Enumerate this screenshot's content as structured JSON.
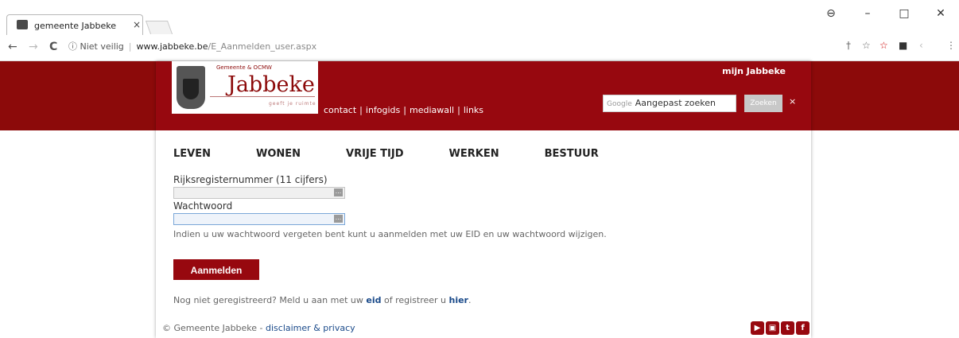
{
  "browser": {
    "tab_title": "gemeente Jabbeke",
    "tab_close": "×",
    "window_buttons": [
      "⊖",
      "–",
      "□",
      "✕"
    ],
    "nav": {
      "back": "←",
      "forward": "→",
      "reload": "C"
    },
    "security": "ⓘ Niet veilig",
    "host": "www.jabbeke.be",
    "path": "/E_Aanmelden_user.aspx"
  },
  "header": {
    "logo_top": "Gemeente & OCMW",
    "logo_name": "Jabbeke",
    "logo_tag": "geeft je ruimte",
    "links": [
      "contact",
      "infogids",
      "mediawall",
      "links"
    ],
    "mijn": "mijn Jabbeke",
    "search_brand": "Google",
    "search_placeholder": "Aangepast zoeken",
    "search_button": "Zoeken",
    "search_close": "×"
  },
  "menu": [
    "LEVEN",
    "WONEN",
    "VRIJE TIJD",
    "WERKEN",
    "BESTUUR"
  ],
  "form": {
    "rrn_label": "Rijksregisternummer (11 cijfers)",
    "password_label": "Wachtwoord",
    "hint": "Indien u uw wachtwoord vergeten bent kunt u aanmelden met uw EID en uw wachtwoord wijzigen.",
    "submit": "Aanmelden",
    "register_text1": "Nog niet geregistreerd? Meld u aan met uw ",
    "register_eid": "eid",
    "register_text2": " of registreer u ",
    "register_here": "hier",
    "register_end": "."
  },
  "footer": {
    "copyright": "© Gemeente Jabbeke - ",
    "disclaimer": "disclaimer & privacy",
    "social": [
      "youtube-icon",
      "instagram-icon",
      "twitter-icon",
      "facebook-icon"
    ]
  }
}
